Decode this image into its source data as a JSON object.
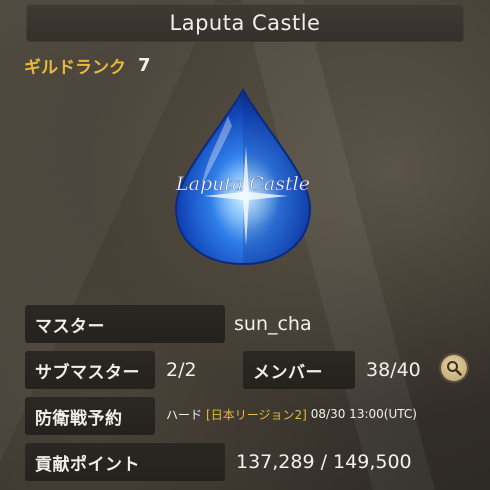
{
  "title": "Laputa Castle",
  "guild_rank": {
    "label": "ギルドランク",
    "value": "7"
  },
  "crest": {
    "text": "Laputa Castle",
    "icon": "blue-drop-crest"
  },
  "info": {
    "master_label": "マスター",
    "master_value": "sun_cha",
    "submaster_label": "サブマスター",
    "submaster_value": "2/2",
    "member_label": "メンバー",
    "member_value": "38/40",
    "defense_label": "防衛戦予約",
    "defense_difficulty": "ハード",
    "defense_region": "[日本リージョン2]",
    "defense_time": "08/30 13:00(UTC)",
    "contribution_label": "貢献ポイント",
    "contribution_value": "137,289 / 149,500"
  },
  "colors": {
    "accent": "#e8b93c",
    "text": "#f1eee7",
    "label_bg": "#2b2722",
    "crest_blue": "#2f7de8"
  }
}
